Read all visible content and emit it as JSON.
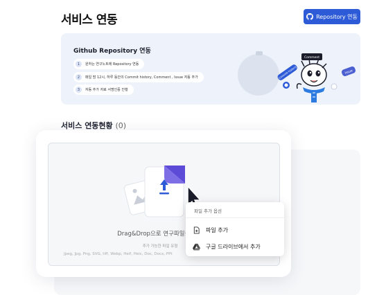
{
  "header": {
    "title": "서비스 연동",
    "repo_button_label": "Repository 연동"
  },
  "banner": {
    "title": "Github Repository 연동",
    "steps": [
      {
        "num": "1",
        "text": "원하는 연구노트에 Repository 연동"
      },
      {
        "num": "2",
        "text": "매일 밤 12시, 하루 동안의 Commit history, Comment , Issue 자동 추가"
      },
      {
        "num": "3",
        "text": "자동 추가 자료 서명인증 진행"
      }
    ],
    "tags": [
      "Comment",
      "Commit history",
      "Issue"
    ]
  },
  "section": {
    "title": "서비스 연동현황",
    "count": "(0)"
  },
  "upload": {
    "drop_text": "Drag&Drop으로 연구파일을 추가",
    "types_label": "추가 가능한 파일 유형",
    "types": "Jpeg, Jpg, Png, SVG, tiff, Webp, Heif, Heic, Doc, Docx, PPt"
  },
  "menu": {
    "heading": "파일 추가 옵션",
    "items": [
      {
        "label": "파일 추가",
        "icon": "file-add-icon"
      },
      {
        "label": "구글 드라이브에서 추가",
        "icon": "google-drive-icon"
      }
    ]
  }
}
